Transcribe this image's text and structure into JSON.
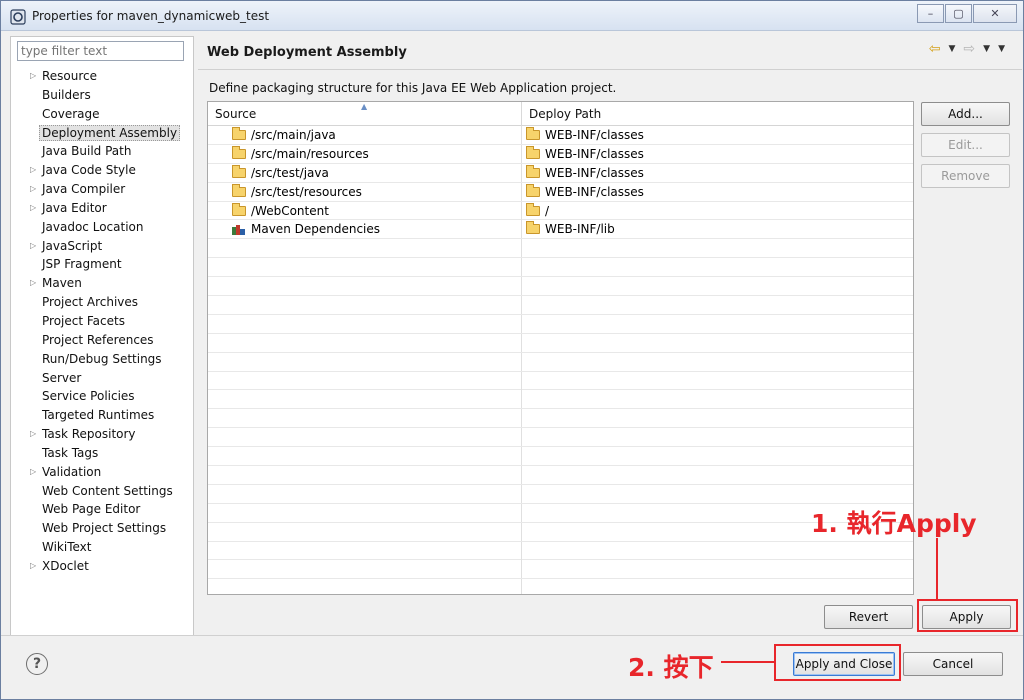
{
  "window": {
    "title": "Properties for maven_dynamicweb_test",
    "minimize": "–",
    "maximize": "▢",
    "close": "✕"
  },
  "filter": {
    "placeholder": "type filter text"
  },
  "nav": [
    {
      "label": "Resource",
      "expandable": true
    },
    {
      "label": "Builders",
      "expandable": false
    },
    {
      "label": "Coverage",
      "expandable": false
    },
    {
      "label": "Deployment Assembly",
      "expandable": false,
      "selected": true
    },
    {
      "label": "Java Build Path",
      "expandable": false
    },
    {
      "label": "Java Code Style",
      "expandable": true
    },
    {
      "label": "Java Compiler",
      "expandable": true
    },
    {
      "label": "Java Editor",
      "expandable": true
    },
    {
      "label": "Javadoc Location",
      "expandable": false
    },
    {
      "label": "JavaScript",
      "expandable": true
    },
    {
      "label": "JSP Fragment",
      "expandable": false
    },
    {
      "label": "Maven",
      "expandable": true
    },
    {
      "label": "Project Archives",
      "expandable": false
    },
    {
      "label": "Project Facets",
      "expandable": false
    },
    {
      "label": "Project References",
      "expandable": false
    },
    {
      "label": "Run/Debug Settings",
      "expandable": false
    },
    {
      "label": "Server",
      "expandable": false
    },
    {
      "label": "Service Policies",
      "expandable": false
    },
    {
      "label": "Targeted Runtimes",
      "expandable": false
    },
    {
      "label": "Task Repository",
      "expandable": true
    },
    {
      "label": "Task Tags",
      "expandable": false
    },
    {
      "label": "Validation",
      "expandable": true
    },
    {
      "label": "Web Content Settings",
      "expandable": false
    },
    {
      "label": "Web Page Editor",
      "expandable": false
    },
    {
      "label": "Web Project Settings",
      "expandable": false
    },
    {
      "label": "WikiText",
      "expandable": false
    },
    {
      "label": "XDoclet",
      "expandable": true
    }
  ],
  "page": {
    "heading": "Web Deployment Assembly",
    "description": "Define packaging structure for this Java EE Web Application project."
  },
  "table": {
    "columns": [
      "Source",
      "Deploy Path"
    ],
    "rows": [
      {
        "source": "/src/main/java",
        "source_icon": "folder-icon",
        "deploy": "WEB-INF/classes"
      },
      {
        "source": "/src/main/resources",
        "source_icon": "folder-icon",
        "deploy": "WEB-INF/classes"
      },
      {
        "source": "/src/test/java",
        "source_icon": "folder-icon",
        "deploy": "WEB-INF/classes"
      },
      {
        "source": "/src/test/resources",
        "source_icon": "folder-icon",
        "deploy": "WEB-INF/classes"
      },
      {
        "source": "/WebContent",
        "source_icon": "folder-icon",
        "deploy": "/"
      },
      {
        "source": "Maven Dependencies",
        "source_icon": "maven-library-icon",
        "deploy": "WEB-INF/lib"
      }
    ]
  },
  "buttons": {
    "add": "Add...",
    "edit": "Edit...",
    "remove": "Remove",
    "revert": "Revert",
    "apply": "Apply",
    "apply_close": "Apply and Close",
    "cancel": "Cancel"
  },
  "help": "?",
  "annotations": {
    "step1": "1. 執行Apply",
    "step2": "2. 按下"
  },
  "colors": {
    "annotation": "#e8262b",
    "folder": "#f7d36b",
    "focus": "#3a7bd5"
  }
}
